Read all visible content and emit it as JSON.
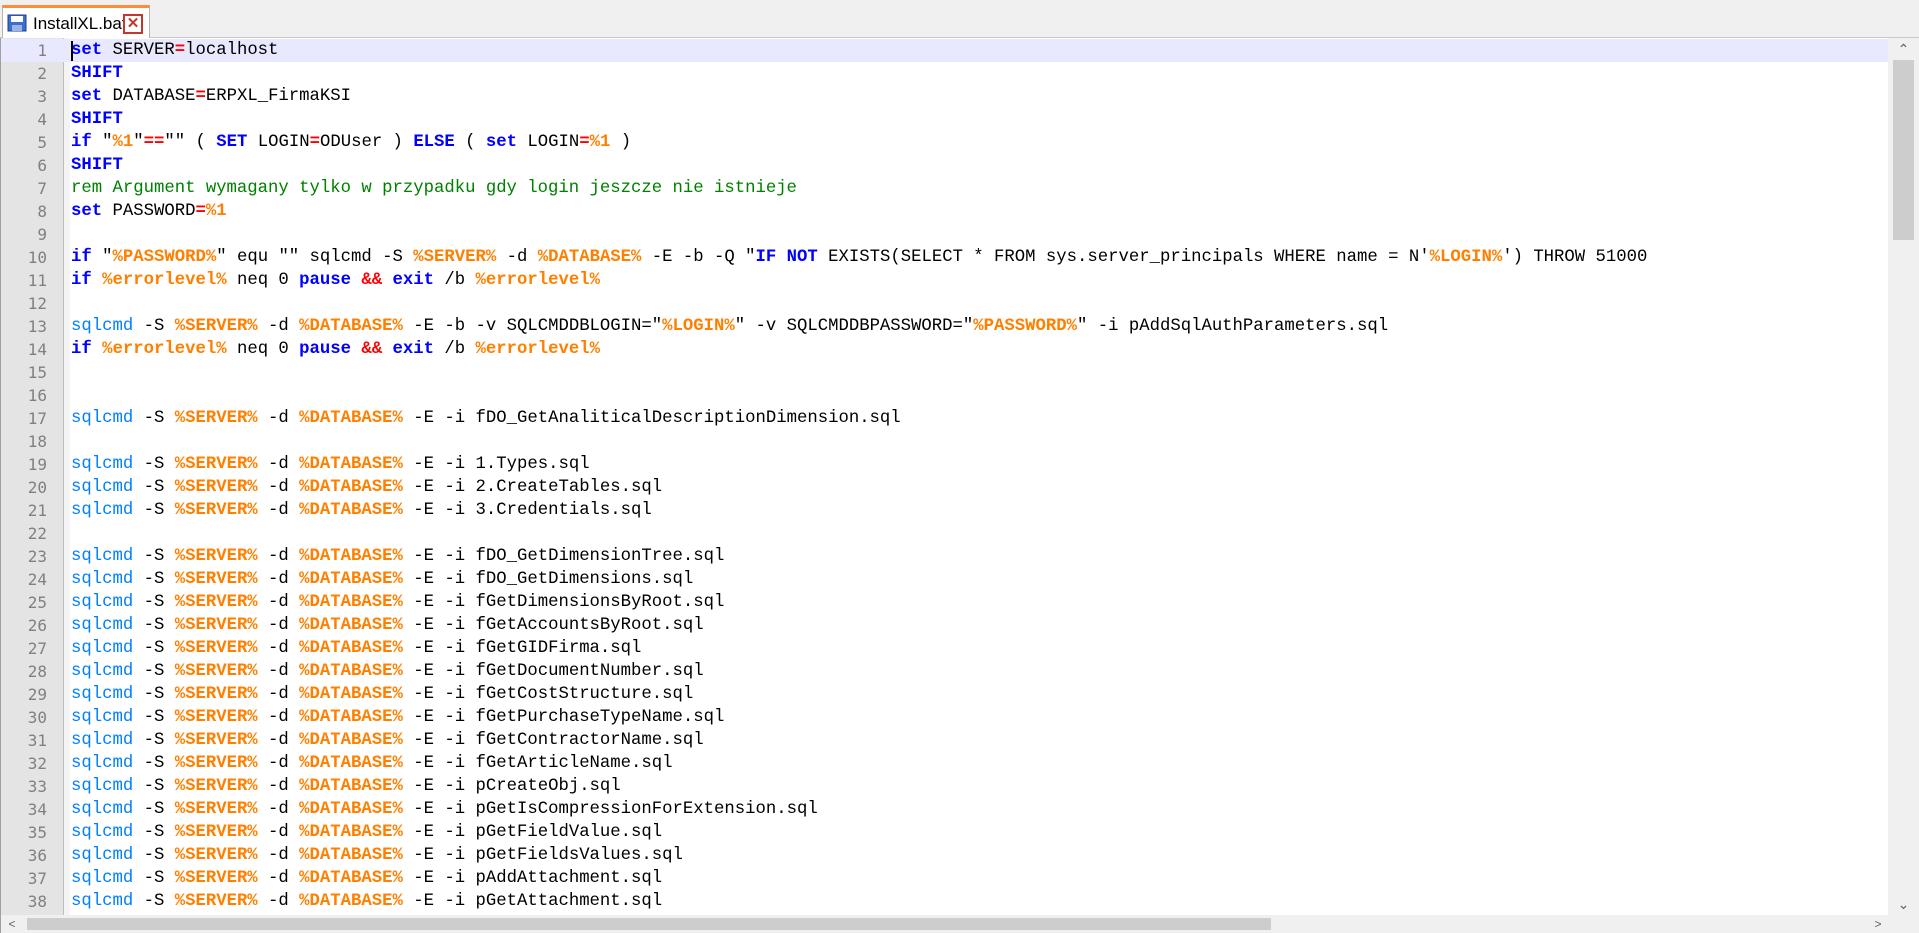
{
  "tab": {
    "title": "InstallXL.bat",
    "close_glyph": "✕",
    "icon": "save-icon"
  },
  "colors": {
    "keyword": "#0000ff",
    "operator": "#ff0000",
    "variable": "#ff8000",
    "comment": "#008000",
    "command": "#0080ff",
    "tab_accent": "#fa8c3c",
    "active_line": "#e8e8ff"
  },
  "scroll": {
    "up": "⌃",
    "down": "⌄",
    "left": "<",
    "right": ">"
  },
  "lines": [
    [
      [
        "kw",
        "set"
      ],
      [
        "plain",
        " SERVER"
      ],
      [
        "op",
        "="
      ],
      [
        "plain",
        "localhost"
      ]
    ],
    [
      [
        "kw",
        "SHIFT"
      ]
    ],
    [
      [
        "kw",
        "set"
      ],
      [
        "plain",
        " DATABASE"
      ],
      [
        "op",
        "="
      ],
      [
        "plain",
        "ERPXL_FirmaKSI"
      ]
    ],
    [
      [
        "kw",
        "SHIFT"
      ]
    ],
    [
      [
        "kw",
        "if"
      ],
      [
        "plain",
        " \""
      ],
      [
        "var",
        "%1"
      ],
      [
        "plain",
        "\""
      ],
      [
        "op",
        "=="
      ],
      [
        "plain",
        "\"\" ( "
      ],
      [
        "kw",
        "SET"
      ],
      [
        "plain",
        " LOGIN"
      ],
      [
        "op",
        "="
      ],
      [
        "plain",
        "ODUser ) "
      ],
      [
        "kw",
        "ELSE"
      ],
      [
        "plain",
        " ( "
      ],
      [
        "kw",
        "set"
      ],
      [
        "plain",
        " LOGIN"
      ],
      [
        "op",
        "="
      ],
      [
        "var",
        "%1"
      ],
      [
        "plain",
        " )"
      ]
    ],
    [
      [
        "kw",
        "SHIFT"
      ]
    ],
    [
      [
        "cmt",
        "rem Argument wymagany tylko w przypadku gdy login jeszcze nie istnieje"
      ]
    ],
    [
      [
        "kw",
        "set"
      ],
      [
        "plain",
        " PASSWORD"
      ],
      [
        "op",
        "="
      ],
      [
        "var",
        "%1"
      ]
    ],
    [],
    [
      [
        "kw",
        "if"
      ],
      [
        "plain",
        " \""
      ],
      [
        "var",
        "%PASSWORD%"
      ],
      [
        "plain",
        "\" equ \"\" sqlcmd -S "
      ],
      [
        "var",
        "%SERVER%"
      ],
      [
        "plain",
        " -d "
      ],
      [
        "var",
        "%DATABASE%"
      ],
      [
        "plain",
        " -E -b -Q \""
      ],
      [
        "kw",
        "IF NOT"
      ],
      [
        "plain",
        " EXISTS(SELECT * FROM sys.server_principals WHERE name = N'"
      ],
      [
        "var",
        "%LOGIN%"
      ],
      [
        "plain",
        "') THROW 51000"
      ]
    ],
    [
      [
        "kw",
        "if"
      ],
      [
        "plain",
        " "
      ],
      [
        "var",
        "%errorlevel%"
      ],
      [
        "plain",
        " neq 0 "
      ],
      [
        "kw",
        "pause"
      ],
      [
        "plain",
        " "
      ],
      [
        "op",
        "&&"
      ],
      [
        "plain",
        " "
      ],
      [
        "kw",
        "exit"
      ],
      [
        "plain",
        " /b "
      ],
      [
        "var",
        "%errorlevel%"
      ]
    ],
    [],
    [
      [
        "cmd",
        "sqlcmd"
      ],
      [
        "plain",
        " -S "
      ],
      [
        "var",
        "%SERVER%"
      ],
      [
        "plain",
        " -d "
      ],
      [
        "var",
        "%DATABASE%"
      ],
      [
        "plain",
        " -E -b -v SQLCMDDBLOGIN=\""
      ],
      [
        "var",
        "%LOGIN%"
      ],
      [
        "plain",
        "\" -v SQLCMDDBPASSWORD=\""
      ],
      [
        "var",
        "%PASSWORD%"
      ],
      [
        "plain",
        "\" -i pAddSqlAuthParameters.sql"
      ]
    ],
    [
      [
        "kw",
        "if"
      ],
      [
        "plain",
        " "
      ],
      [
        "var",
        "%errorlevel%"
      ],
      [
        "plain",
        " neq 0 "
      ],
      [
        "kw",
        "pause"
      ],
      [
        "plain",
        " "
      ],
      [
        "op",
        "&&"
      ],
      [
        "plain",
        " "
      ],
      [
        "kw",
        "exit"
      ],
      [
        "plain",
        " /b "
      ],
      [
        "var",
        "%errorlevel%"
      ]
    ],
    [],
    [],
    [
      [
        "cmd",
        "sqlcmd"
      ],
      [
        "plain",
        " -S "
      ],
      [
        "var",
        "%SERVER%"
      ],
      [
        "plain",
        " -d "
      ],
      [
        "var",
        "%DATABASE%"
      ],
      [
        "plain",
        " -E -i fDO_GetAnaliticalDescriptionDimension.sql"
      ]
    ],
    [],
    [
      [
        "cmd",
        "sqlcmd"
      ],
      [
        "plain",
        " -S "
      ],
      [
        "var",
        "%SERVER%"
      ],
      [
        "plain",
        " -d "
      ],
      [
        "var",
        "%DATABASE%"
      ],
      [
        "plain",
        " -E -i 1.Types.sql"
      ]
    ],
    [
      [
        "cmd",
        "sqlcmd"
      ],
      [
        "plain",
        " -S "
      ],
      [
        "var",
        "%SERVER%"
      ],
      [
        "plain",
        " -d "
      ],
      [
        "var",
        "%DATABASE%"
      ],
      [
        "plain",
        " -E -i 2.CreateTables.sql"
      ]
    ],
    [
      [
        "cmd",
        "sqlcmd"
      ],
      [
        "plain",
        " -S "
      ],
      [
        "var",
        "%SERVER%"
      ],
      [
        "plain",
        " -d "
      ],
      [
        "var",
        "%DATABASE%"
      ],
      [
        "plain",
        " -E -i 3.Credentials.sql"
      ]
    ],
    [],
    [
      [
        "cmd",
        "sqlcmd"
      ],
      [
        "plain",
        " -S "
      ],
      [
        "var",
        "%SERVER%"
      ],
      [
        "plain",
        " -d "
      ],
      [
        "var",
        "%DATABASE%"
      ],
      [
        "plain",
        " -E -i fDO_GetDimensionTree.sql"
      ]
    ],
    [
      [
        "cmd",
        "sqlcmd"
      ],
      [
        "plain",
        " -S "
      ],
      [
        "var",
        "%SERVER%"
      ],
      [
        "plain",
        " -d "
      ],
      [
        "var",
        "%DATABASE%"
      ],
      [
        "plain",
        " -E -i fDO_GetDimensions.sql"
      ]
    ],
    [
      [
        "cmd",
        "sqlcmd"
      ],
      [
        "plain",
        " -S "
      ],
      [
        "var",
        "%SERVER%"
      ],
      [
        "plain",
        " -d "
      ],
      [
        "var",
        "%DATABASE%"
      ],
      [
        "plain",
        " -E -i fGetDimensionsByRoot.sql"
      ]
    ],
    [
      [
        "cmd",
        "sqlcmd"
      ],
      [
        "plain",
        " -S "
      ],
      [
        "var",
        "%SERVER%"
      ],
      [
        "plain",
        " -d "
      ],
      [
        "var",
        "%DATABASE%"
      ],
      [
        "plain",
        " -E -i fGetAccountsByRoot.sql"
      ]
    ],
    [
      [
        "cmd",
        "sqlcmd"
      ],
      [
        "plain",
        " -S "
      ],
      [
        "var",
        "%SERVER%"
      ],
      [
        "plain",
        " -d "
      ],
      [
        "var",
        "%DATABASE%"
      ],
      [
        "plain",
        " -E -i fGetGIDFirma.sql"
      ]
    ],
    [
      [
        "cmd",
        "sqlcmd"
      ],
      [
        "plain",
        " -S "
      ],
      [
        "var",
        "%SERVER%"
      ],
      [
        "plain",
        " -d "
      ],
      [
        "var",
        "%DATABASE%"
      ],
      [
        "plain",
        " -E -i fGetDocumentNumber.sql"
      ]
    ],
    [
      [
        "cmd",
        "sqlcmd"
      ],
      [
        "plain",
        " -S "
      ],
      [
        "var",
        "%SERVER%"
      ],
      [
        "plain",
        " -d "
      ],
      [
        "var",
        "%DATABASE%"
      ],
      [
        "plain",
        " -E -i fGetCostStructure.sql"
      ]
    ],
    [
      [
        "cmd",
        "sqlcmd"
      ],
      [
        "plain",
        " -S "
      ],
      [
        "var",
        "%SERVER%"
      ],
      [
        "plain",
        " -d "
      ],
      [
        "var",
        "%DATABASE%"
      ],
      [
        "plain",
        " -E -i fGetPurchaseTypeName.sql"
      ]
    ],
    [
      [
        "cmd",
        "sqlcmd"
      ],
      [
        "plain",
        " -S "
      ],
      [
        "var",
        "%SERVER%"
      ],
      [
        "plain",
        " -d "
      ],
      [
        "var",
        "%DATABASE%"
      ],
      [
        "plain",
        " -E -i fGetContractorName.sql"
      ]
    ],
    [
      [
        "cmd",
        "sqlcmd"
      ],
      [
        "plain",
        " -S "
      ],
      [
        "var",
        "%SERVER%"
      ],
      [
        "plain",
        " -d "
      ],
      [
        "var",
        "%DATABASE%"
      ],
      [
        "plain",
        " -E -i fGetArticleName.sql"
      ]
    ],
    [
      [
        "cmd",
        "sqlcmd"
      ],
      [
        "plain",
        " -S "
      ],
      [
        "var",
        "%SERVER%"
      ],
      [
        "plain",
        " -d "
      ],
      [
        "var",
        "%DATABASE%"
      ],
      [
        "plain",
        " -E -i pCreateObj.sql"
      ]
    ],
    [
      [
        "cmd",
        "sqlcmd"
      ],
      [
        "plain",
        " -S "
      ],
      [
        "var",
        "%SERVER%"
      ],
      [
        "plain",
        " -d "
      ],
      [
        "var",
        "%DATABASE%"
      ],
      [
        "plain",
        " -E -i pGetIsCompressionForExtension.sql"
      ]
    ],
    [
      [
        "cmd",
        "sqlcmd"
      ],
      [
        "plain",
        " -S "
      ],
      [
        "var",
        "%SERVER%"
      ],
      [
        "plain",
        " -d "
      ],
      [
        "var",
        "%DATABASE%"
      ],
      [
        "plain",
        " -E -i pGetFieldValue.sql"
      ]
    ],
    [
      [
        "cmd",
        "sqlcmd"
      ],
      [
        "plain",
        " -S "
      ],
      [
        "var",
        "%SERVER%"
      ],
      [
        "plain",
        " -d "
      ],
      [
        "var",
        "%DATABASE%"
      ],
      [
        "plain",
        " -E -i pGetFieldsValues.sql"
      ]
    ],
    [
      [
        "cmd",
        "sqlcmd"
      ],
      [
        "plain",
        " -S "
      ],
      [
        "var",
        "%SERVER%"
      ],
      [
        "plain",
        " -d "
      ],
      [
        "var",
        "%DATABASE%"
      ],
      [
        "plain",
        " -E -i pAddAttachment.sql"
      ]
    ],
    [
      [
        "cmd",
        "sqlcmd"
      ],
      [
        "plain",
        " -S "
      ],
      [
        "var",
        "%SERVER%"
      ],
      [
        "plain",
        " -d "
      ],
      [
        "var",
        "%DATABASE%"
      ],
      [
        "plain",
        " -E -i pGetAttachment.sql"
      ]
    ]
  ]
}
